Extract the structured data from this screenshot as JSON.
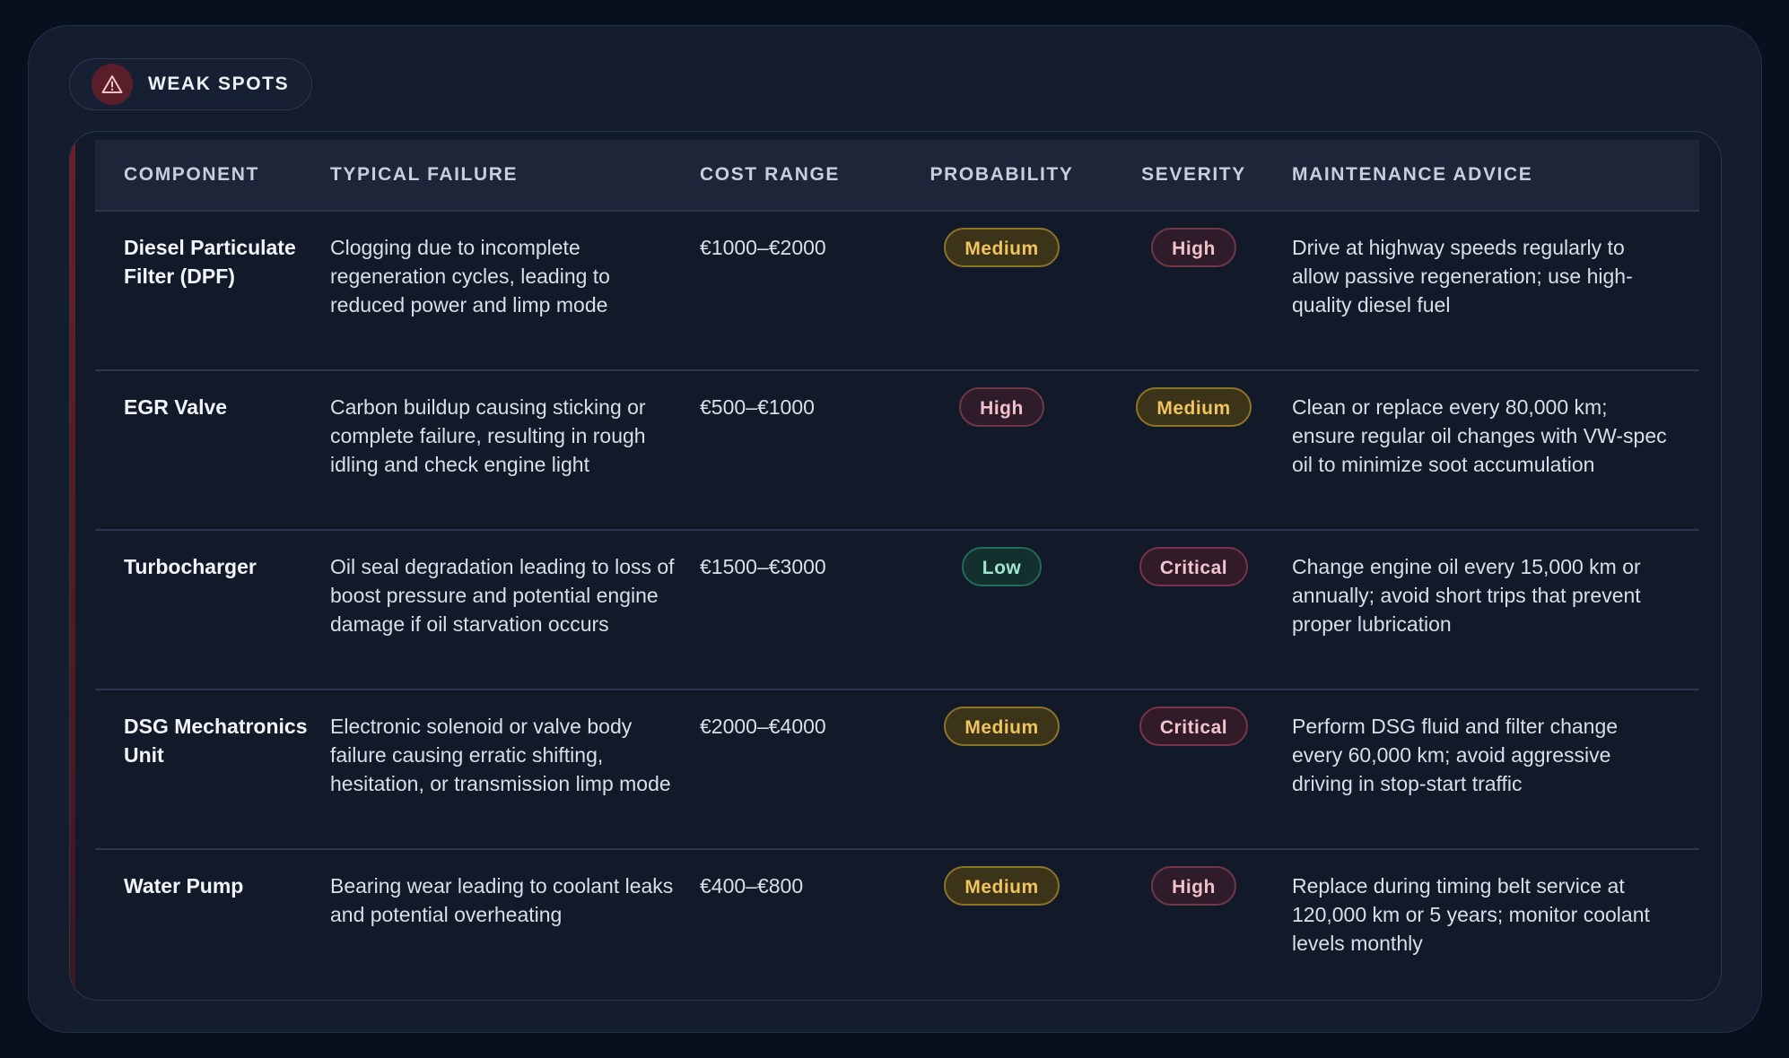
{
  "section": {
    "label": "WEAK SPOTS",
    "icon": "warning-triangle-icon",
    "icon_color": "#f3c4cd"
  },
  "columns": {
    "component": "COMPONENT",
    "failure": "TYPICAL FAILURE",
    "cost": "COST RANGE",
    "probability": "PROBABILITY",
    "severity": "SEVERITY",
    "advice": "MAINTENANCE ADVICE"
  },
  "rows": [
    {
      "component": "Diesel Particulate Filter (DPF)",
      "failure": "Clogging due to incomplete regeneration cycles, leading to reduced power and limp mode",
      "cost": "€1000–€2000",
      "probability": "Medium",
      "severity": "High",
      "advice": "Drive at highway speeds regularly to allow passive regeneration; use high-quality diesel fuel"
    },
    {
      "component": "EGR Valve",
      "failure": "Carbon buildup causing sticking or complete failure, resulting in rough idling and check engine light",
      "cost": "€500–€1000",
      "probability": "High",
      "severity": "Medium",
      "advice": "Clean or replace every 80,000 km; ensure regular oil changes with VW-spec oil to minimize soot accumulation"
    },
    {
      "component": "Turbocharger",
      "failure": "Oil seal degradation leading to loss of boost pressure and potential engine damage if oil starvation occurs",
      "cost": "€1500–€3000",
      "probability": "Low",
      "severity": "Critical",
      "advice": "Change engine oil every 15,000 km or annually; avoid short trips that prevent proper lubrication"
    },
    {
      "component": "DSG Mechatronics Unit",
      "failure": "Electronic solenoid or valve body failure causing erratic shifting, hesitation, or transmission limp mode",
      "cost": "€2000–€4000",
      "probability": "Medium",
      "severity": "Critical",
      "advice": "Perform DSG fluid and filter change every 60,000 km; avoid aggressive driving in stop-start traffic"
    },
    {
      "component": "Water Pump",
      "failure": "Bearing wear leading to coolant leaks and potential overheating",
      "cost": "€400–€800",
      "probability": "Medium",
      "severity": "High",
      "advice": "Replace during timing belt service at 120,000 km or 5 years; monitor coolant levels monthly"
    }
  ],
  "colors": {
    "background": "#07101c",
    "panel": "#141d2e",
    "accent": "#6a1f27",
    "medium": "#f0c45e",
    "high": "#f0c1c9",
    "critical": "#f3c4cd",
    "low": "#9fe6cf"
  }
}
